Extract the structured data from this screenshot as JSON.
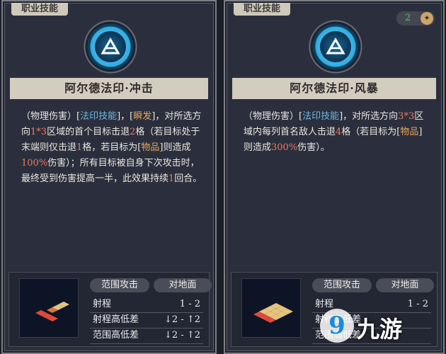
{
  "cards": [
    {
      "tag": "职业技能",
      "title": "阿尔德法印·冲击",
      "desc": {
        "p1": "（物理伤害）[",
        "skill": "法印技能",
        "p2": "]，[",
        "instant": "瞬发",
        "p3": "]，对所选方向",
        "area": "1*3",
        "p4": "区域的首个目标击退",
        "knock": "2",
        "p5": "格（若目标处于末端则仅击退",
        "knock2": "1",
        "p6": "格，若目标为[",
        "item": "物品",
        "p7": "]则造成",
        "pct": "100%",
        "p8": "伤害）；所有目标被自身下次攻击时，最终受到伤害提高一半，此效果持续",
        "turns": "1",
        "p9": "回合。"
      },
      "stats": {
        "attack_type": "范围攻击",
        "target_type": "对地面",
        "range_label": "射程",
        "range_value": "1 - 2",
        "height_label": "射程高低差",
        "height_value": "↓2 - ↑2",
        "area_height_label": "范围高低差",
        "area_height_value": "↓2 - ↑2"
      }
    },
    {
      "tag": "职业技能",
      "title": "阿尔德法印·风暴",
      "counter": "2",
      "desc": {
        "p1": "（物理伤害）[",
        "skill": "法印技能",
        "p2": "]，对所选方向",
        "area": "3*3",
        "p3": "区域内每列首名敌人击退",
        "knock": "4",
        "p4": "格（若目标为[",
        "item": "物品",
        "p5": "]则造成",
        "pct": "300%",
        "p6": "伤害）。"
      },
      "stats": {
        "attack_type": "范围攻击",
        "target_type": "对地面",
        "range_label": "射程",
        "range_value": "1 - 2",
        "height_label": "射程高低差",
        "area_height_label": "范围高低差"
      }
    }
  ],
  "watermark": {
    "logo": "9",
    "name": "九游"
  },
  "colors": {
    "skill": "#6cb8e6",
    "instant": "#e8a85a",
    "number": "#e97a61"
  }
}
